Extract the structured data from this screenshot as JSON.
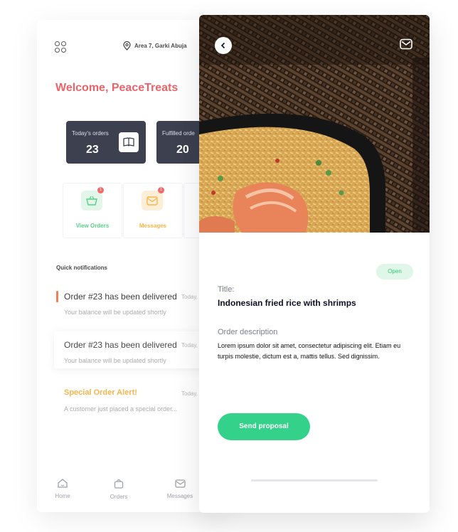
{
  "back_screen": {
    "location": "Area 7, Garki Abuja",
    "welcome": "Welcome, PeaceTreats",
    "stats": [
      {
        "label": "Today's orders",
        "value": "23"
      },
      {
        "label": "Fulfilled orde",
        "value": "20"
      }
    ],
    "tiles": [
      {
        "label": "View Orders",
        "badge": "1",
        "color": "#35c46f",
        "bg": "#dcf6e6"
      },
      {
        "label": "Messages",
        "badge": "1",
        "color": "#f5a623",
        "bg": "#fdeccf"
      }
    ],
    "quick_notifications_title": "Quick notifications",
    "notifications": [
      {
        "title": "Order #23 has been delivered",
        "date": "Today,",
        "subtitle": "Your balance will be updated shortly"
      },
      {
        "title": "Order #23 has been delivered",
        "date": "Today,",
        "subtitle": "Your balance will be updated shortly"
      },
      {
        "title": "Special Order Alert!",
        "date": "Today,",
        "subtitle": "A customer just placed a special order..."
      }
    ],
    "nav": [
      {
        "label": "Home",
        "icon": "home-icon"
      },
      {
        "label": "Orders",
        "icon": "bag-icon"
      },
      {
        "label": "Messages",
        "icon": "mail-icon"
      }
    ]
  },
  "detail": {
    "status_badge": "Open",
    "title_label": "Title:",
    "title_value": "Indonesian fried rice with shrimps",
    "description_label": "Order description",
    "description_value": "Lorem ipsum dolor sit amet, consectetur adipiscing elit. Etiam eu turpis molestie, dictum est a, mattis tellus. Sed dignissim.",
    "send_button": "Send proposal"
  },
  "colors": {
    "accent_red": "#e8434b",
    "accent_green": "#34d18a",
    "dark_card": "#121629",
    "accent_orange": "#f5a623"
  }
}
